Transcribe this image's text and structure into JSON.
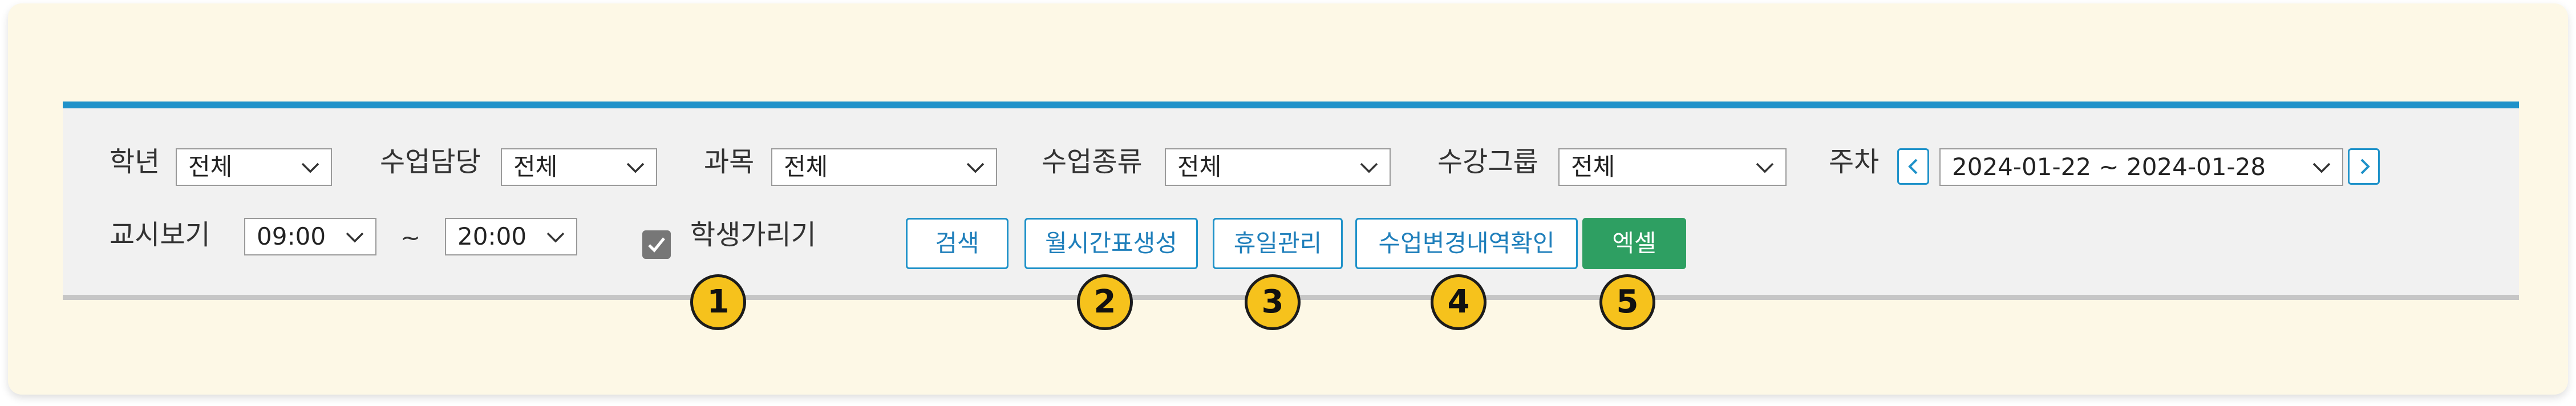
{
  "filters": {
    "grade": {
      "label": "학년",
      "value": "전체"
    },
    "teacher": {
      "label": "수업담당",
      "value": "전체"
    },
    "subject": {
      "label": "과목",
      "value": "전체"
    },
    "class_type": {
      "label": "수업종류",
      "value": "전체"
    },
    "course_group": {
      "label": "수강그룹",
      "value": "전체"
    },
    "week": {
      "label": "주차",
      "value": "2024-01-22 ~ 2024-01-28"
    }
  },
  "period_view": {
    "label": "교시보기",
    "start": "09:00",
    "separator": "~",
    "end": "20:00"
  },
  "hide_students": {
    "label": "학생가리기",
    "checked": true
  },
  "buttons": {
    "search": "검색",
    "generate_timetable": "월시간표생성",
    "holiday_management": "휴일관리",
    "class_change_history": "수업변경내역확인",
    "excel": "엑셀"
  },
  "callouts": [
    "1",
    "2",
    "3",
    "4",
    "5"
  ],
  "colors": {
    "accent": "#1f92c9",
    "excel": "#2e9f62",
    "callout": "#f6c21c",
    "card_background": "#fdf8e6"
  },
  "icons": {
    "dropdown": "chevron-down-icon",
    "prev_week": "chevron-left-icon",
    "next_week": "chevron-right-icon",
    "checkbox": "checkmark-icon"
  }
}
